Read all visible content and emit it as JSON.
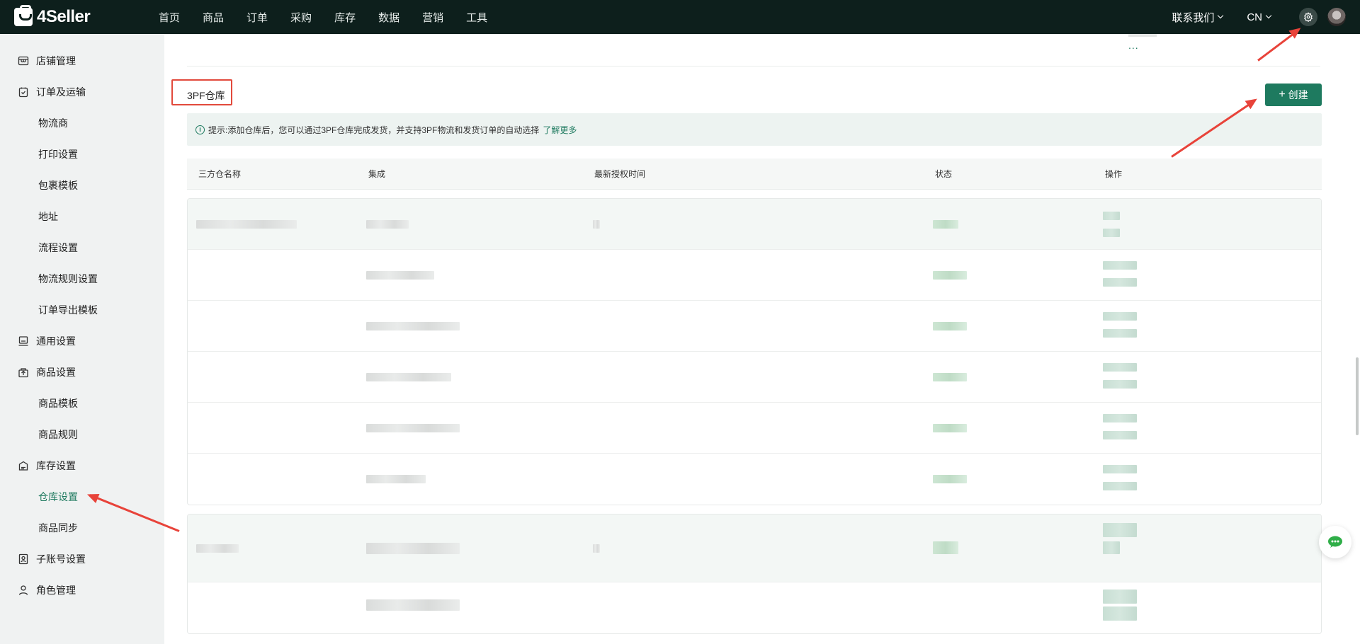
{
  "brand": {
    "name": "4Seller"
  },
  "nav": {
    "items": [
      "首页",
      "商品",
      "订单",
      "采购",
      "库存",
      "数据",
      "营销",
      "工具"
    ]
  },
  "topbar": {
    "contact": "联系我们",
    "language": "CN"
  },
  "sidebar": {
    "items": [
      {
        "label": "店铺管理",
        "type": "group",
        "icon": "store-icon"
      },
      {
        "label": "订单及运输",
        "type": "group",
        "icon": "order-icon"
      },
      {
        "label": "物流商",
        "type": "sub"
      },
      {
        "label": "打印设置",
        "type": "sub"
      },
      {
        "label": "包裹模板",
        "type": "sub"
      },
      {
        "label": "地址",
        "type": "sub"
      },
      {
        "label": "流程设置",
        "type": "sub"
      },
      {
        "label": "物流规则设置",
        "type": "sub"
      },
      {
        "label": "订单导出模板",
        "type": "sub"
      },
      {
        "label": "通用设置",
        "type": "group",
        "icon": "monitor-icon"
      },
      {
        "label": "商品设置",
        "type": "group",
        "icon": "upload-box-icon"
      },
      {
        "label": "商品模板",
        "type": "sub"
      },
      {
        "label": "商品规则",
        "type": "sub"
      },
      {
        "label": "库存设置",
        "type": "group",
        "icon": "inventory-icon"
      },
      {
        "label": "仓库设置",
        "type": "sub",
        "active": true
      },
      {
        "label": "商品同步",
        "type": "sub"
      },
      {
        "label": "子账号设置",
        "type": "group",
        "icon": "badge-icon"
      },
      {
        "label": "角色管理",
        "type": "group",
        "icon": "user-icon"
      }
    ]
  },
  "main": {
    "fragment_more": "...",
    "section_title": "3PF仓库",
    "create_label": "创建",
    "tip": {
      "text": "提示:添加仓库后，您可以通过3PF仓库完成发货，并支持3PF物流和发货订单的自动选择",
      "link": "了解更多"
    },
    "table": {
      "columns": [
        "三方仓名称",
        "集成",
        "最新授权时间",
        "状态",
        "操作"
      ]
    }
  },
  "colors": {
    "accent": "#1e7a5f",
    "topbar": "#0d1f1c",
    "annotation": "#e24a3c"
  }
}
